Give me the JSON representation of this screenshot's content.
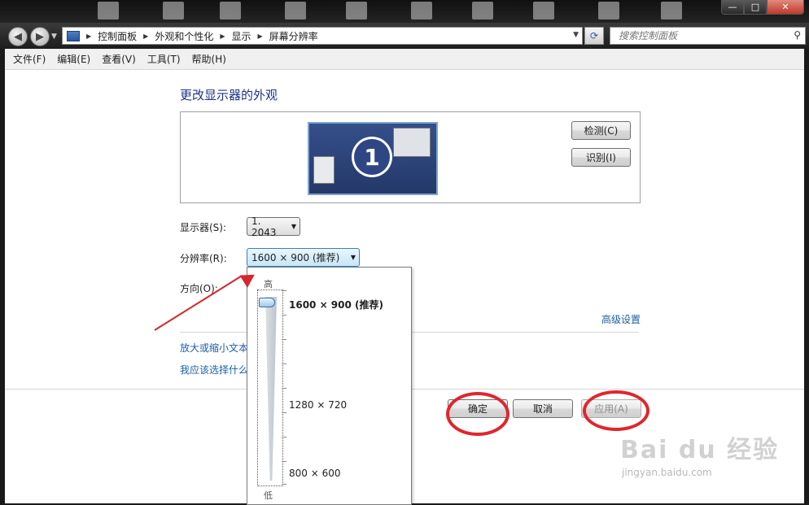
{
  "window_controls": {
    "minimize": "—",
    "maximize": "□",
    "close": "✕"
  },
  "navigation": {
    "back_icon": "back-arrow-icon",
    "forward_icon": "forward-arrow-icon",
    "breadcrumbs": [
      "控制面板",
      "外观和个性化",
      "显示",
      "屏幕分辨率"
    ],
    "search_placeholder": "搜索控制面板"
  },
  "menubar": {
    "items": [
      "文件(F)",
      "编辑(E)",
      "查看(V)",
      "工具(T)",
      "帮助(H)"
    ]
  },
  "main": {
    "heading": "更改显示器的外观",
    "monitor_number": "1",
    "detect_button": "检测(C)",
    "identify_button": "识别(I)",
    "display_label": "显示器(S):",
    "display_value": "1. 2043",
    "resolution_label": "分辨率(R):",
    "resolution_value": "1600 × 900 (推荐)",
    "orientation_label": "方向(O):",
    "advanced_link": "高级设置",
    "link_text_size": "放大或缩小文本",
    "link_which_settings": "我应该选择什么",
    "ok_button": "确定",
    "cancel_button": "取消",
    "apply_button": "应用(A)"
  },
  "resolution_dropdown": {
    "high_label": "高",
    "low_label": "低",
    "options": [
      "1600 × 900 (推荐)",
      "1280 × 720",
      "800 × 600"
    ],
    "selected": "1600 × 900 (推荐)",
    "slider_level": 1.0
  },
  "watermark": {
    "brand": "Bai du 经验",
    "url": "jingyan.baidu.com"
  },
  "colors": {
    "annotation": "#e0262e",
    "link": "#1d5ea8",
    "heading": "#1e3287"
  }
}
